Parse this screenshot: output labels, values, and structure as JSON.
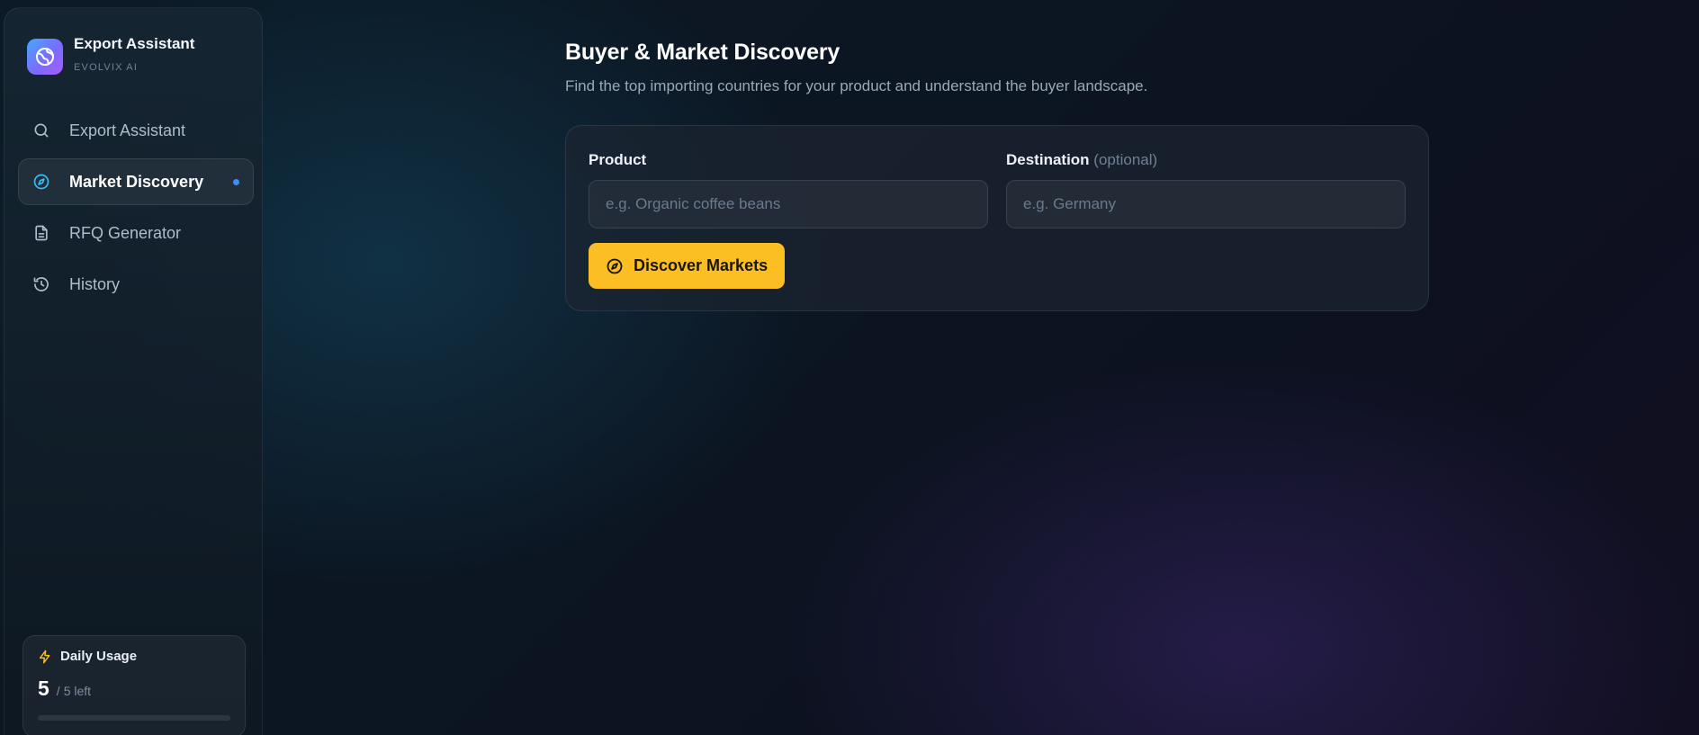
{
  "brand": {
    "title": "Export Assistant",
    "subtitle": "EVOLVIX AI",
    "icon": "globe-icon",
    "gradient": [
      "#46a8ff",
      "#a85cff"
    ]
  },
  "nav": {
    "items": [
      {
        "label": "Export Assistant",
        "icon": "search-icon",
        "active": false
      },
      {
        "label": "Market Discovery",
        "icon": "compass-icon",
        "active": true
      },
      {
        "label": "RFQ Generator",
        "icon": "document-icon",
        "active": false
      },
      {
        "label": "History",
        "icon": "history-icon",
        "active": false
      }
    ]
  },
  "usage": {
    "title": "Daily Usage",
    "icon": "lightning-icon",
    "count": "5",
    "separator": "/",
    "remaining": "5 left",
    "used_fraction": 0
  },
  "main": {
    "title": "Buyer & Market Discovery",
    "subtitle": "Find the top importing countries for your product and understand the buyer landscape.",
    "product": {
      "label": "Product",
      "placeholder": "e.g. Organic coffee beans",
      "value": ""
    },
    "destination": {
      "label": "Destination",
      "optional_label": "(optional)",
      "placeholder": "e.g. Germany",
      "value": ""
    },
    "submit_label": "Discover Markets"
  },
  "colors": {
    "accent_yellow": "#fbbf24",
    "active_dot": "#3c8bff",
    "compass_cyan": "#38bdf8"
  }
}
